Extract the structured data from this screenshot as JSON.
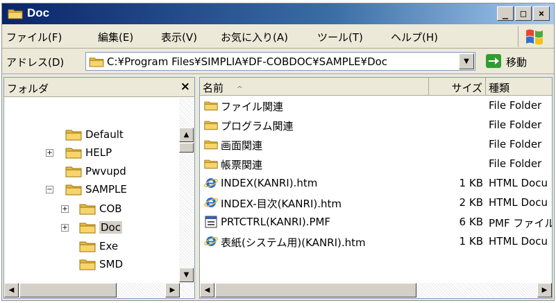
{
  "window": {
    "title": "Doc",
    "minimize_label": "_",
    "maximize_label": "□",
    "close_label": "×"
  },
  "menu": {
    "items": [
      "ファイル(F)",
      "編集(E)",
      "表示(V)",
      "お気に入り(A)",
      "ツール(T)",
      "ヘルプ(H)"
    ]
  },
  "address": {
    "label": "アドレス(D)",
    "value": "C:¥Program Files¥SIMPLIA¥DF-COBDOC¥SAMPLE¥Doc",
    "go_label": "移動"
  },
  "folders": {
    "title": "フォルダ",
    "close_label": "×",
    "items": [
      {
        "label": "Default",
        "expander": ""
      },
      {
        "label": "HELP",
        "expander": "+"
      },
      {
        "label": "Pwvupd",
        "expander": ""
      },
      {
        "label": "SAMPLE",
        "expander": "−"
      },
      {
        "label": "COB",
        "expander": "+"
      },
      {
        "label": "Doc",
        "expander": "+",
        "selected": true
      },
      {
        "label": "Exe",
        "expander": ""
      },
      {
        "label": "SMD",
        "expander": ""
      }
    ]
  },
  "list": {
    "columns": {
      "name": "名前",
      "sort_indicator": "^",
      "size": "サイズ",
      "type": "種類"
    },
    "rows": [
      {
        "icon": "folder-icon",
        "name": "ファイル関連",
        "size": "",
        "type": "File Folder"
      },
      {
        "icon": "folder-icon",
        "name": "プログラム関連",
        "size": "",
        "type": "File Folder"
      },
      {
        "icon": "folder-icon",
        "name": "画面関連",
        "size": "",
        "type": "File Folder"
      },
      {
        "icon": "folder-icon",
        "name": "帳票関連",
        "size": "",
        "type": "File Folder"
      },
      {
        "icon": "ie-html-icon",
        "name": "INDEX(KANRI).htm",
        "size": "1 KB",
        "type": "HTML Docu"
      },
      {
        "icon": "ie-html-icon",
        "name": "INDEX-目次(KANRI).htm",
        "size": "2 KB",
        "type": "HTML Docu"
      },
      {
        "icon": "pmf-file-icon",
        "name": "PRTCTRL(KANRI).PMF",
        "size": "6 KB",
        "type": "PMF ファイル"
      },
      {
        "icon": "ie-html-icon",
        "name": "表紙(システム用)(KANRI).htm",
        "size": "1 KB",
        "type": "HTML Docu"
      }
    ]
  },
  "colors": {
    "title_bar_start": "#0a246a",
    "title_bar_end": "#a6caf0",
    "window_face": "#ece9d8",
    "folder_yellow": "#f7d56a"
  }
}
